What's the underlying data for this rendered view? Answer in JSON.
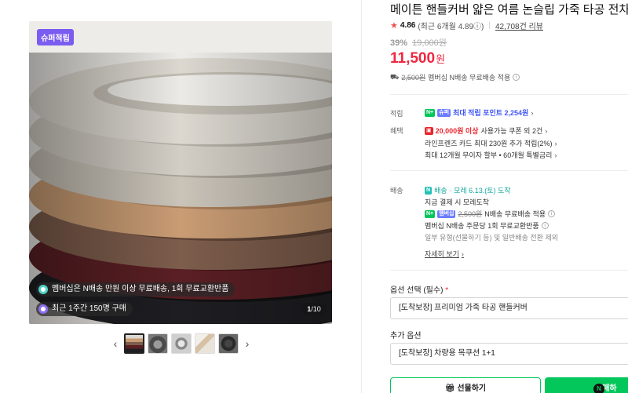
{
  "gallery": {
    "badge": "슈퍼적립",
    "pill_shipping": "멤버십은 N배송 만원 이상 무료배송, 1회 무료교환반품",
    "pill_purchases": "최근 1주간 150명 구매",
    "counter_current": "1",
    "counter_total": "/10",
    "prev_arrow": "‹",
    "next_arrow": "›"
  },
  "product": {
    "title": "메이튼 핸들커버 얇은 여름 논슬립 가죽 타공 전차종",
    "rating_star": "★",
    "rating_score": "4.86",
    "rating_recent": "(최근 6개월 4.89ⓘ)",
    "review_count": "42,708건 리뷰",
    "discount_rate": "39%",
    "original_price": "19,000원",
    "price": "11,500",
    "currency": "원",
    "ship_original": "2,500원",
    "ship_note": "멤버십 N배송 무료배송 적용"
  },
  "benefits": {
    "points_label": "적립",
    "points_text": "최대 적립 포인트 2,254원",
    "points_badge": "N+",
    "points_badge2": "슈퍼",
    "benefit_label": "혜택",
    "coupon_amount": "20,000원 이상",
    "coupon_text": "사용가능 쿠폰 외 2건",
    "card_text": "라인프렌즈 카드 최대 230원 추가 적립(2%)",
    "installment_text": "최대 12개월 무이자 할부 • 60개월 특별금리"
  },
  "delivery": {
    "label": "배송",
    "type": "배송",
    "eta": "· 모레 6.13.(토) 도착",
    "payment_note": "지금 결제 시 모레도착",
    "membership_badge": "멤버십",
    "ship_original": "2,500원",
    "ship_free": "N배송 무료배송 적용",
    "exchange_note": "멤버십 N배송 주문당 1회 무료교환반품",
    "exception_note": "일부 유형(선물하기 등) 및 일반배송 전환 제외",
    "details_link": "자세히 보기"
  },
  "options": {
    "option_label": "옵션 선택 (필수)",
    "required_mark": "*",
    "option_value": "[도착보장] 프리미엄 가죽 타공 핸들커버",
    "addon_label": "추가 옵션",
    "addon_value": "[도착보장] 차량용 목쿠션 1+1"
  },
  "actions": {
    "gift_label": "선물하기",
    "buy_label": "구매하"
  }
}
